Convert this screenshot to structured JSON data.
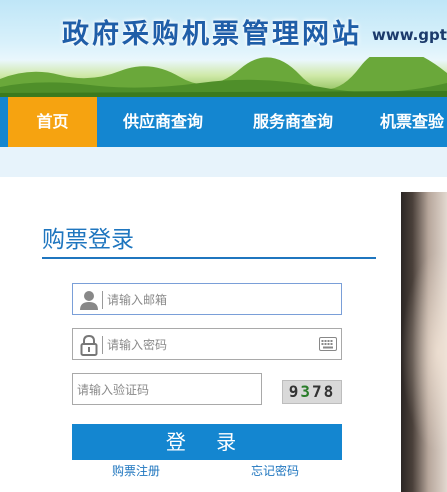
{
  "header": {
    "site_title": "政府采购机票管理网站",
    "site_url": "www.gptic"
  },
  "nav": {
    "items": [
      {
        "label": "首页",
        "active": true
      },
      {
        "label": "供应商查询"
      },
      {
        "label": "服务商查询"
      },
      {
        "label": "机票查验"
      }
    ]
  },
  "login": {
    "title": "购票登录",
    "email_placeholder": "请输入邮箱",
    "password_placeholder": "请输入密码",
    "captcha_placeholder": "请输入验证码",
    "captcha_code": [
      "9",
      "3",
      "7",
      "8"
    ],
    "submit_label": "登 录",
    "register_link": "购票注册",
    "forgot_link": "忘记密码"
  },
  "colors": {
    "nav_bg": "#1486d0",
    "nav_active": "#f6a310",
    "accent_blue": "#1f76bf"
  },
  "icons": {
    "email_field": "user-icon",
    "password_field": "lock-icon",
    "password_keyboard": "keyboard-icon"
  }
}
